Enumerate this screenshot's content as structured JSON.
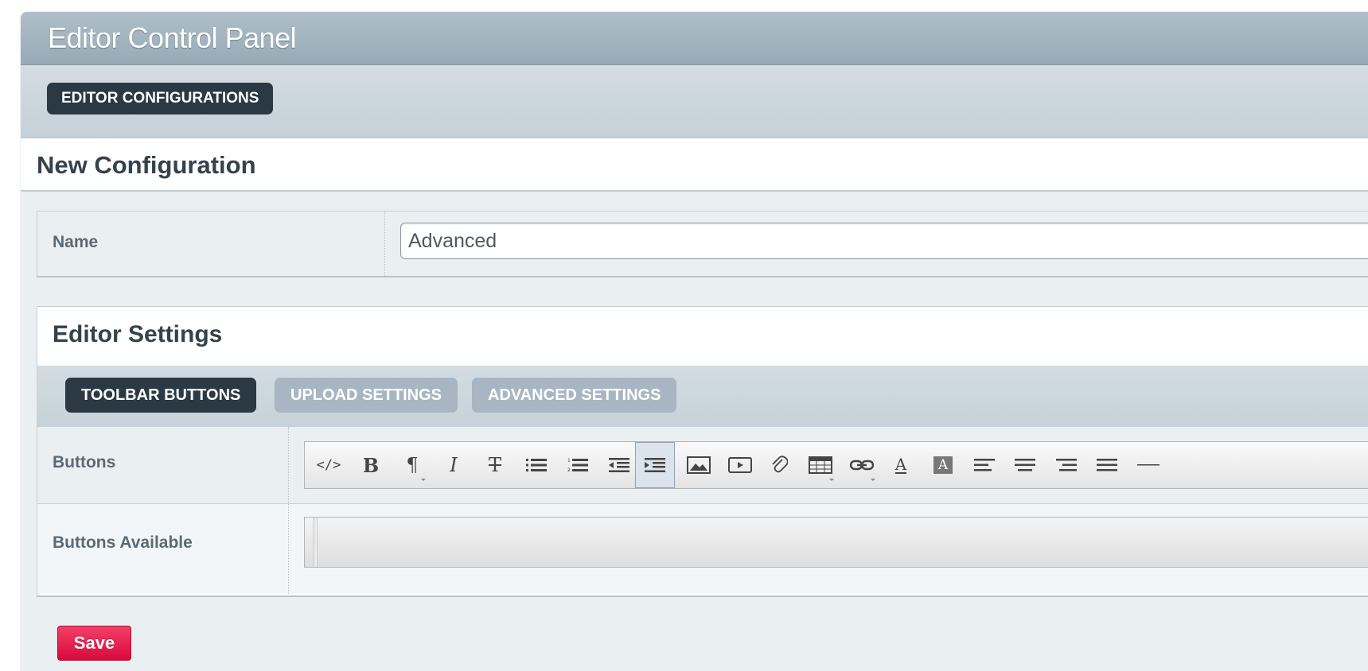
{
  "header": {
    "title": "Editor Control Panel"
  },
  "subnav": {
    "items": [
      {
        "label": "EDITOR CONFIGURATIONS"
      }
    ]
  },
  "page": {
    "heading": "New Configuration"
  },
  "name_field": {
    "label": "Name",
    "value": "Advanced"
  },
  "editor_settings": {
    "title": "Editor Settings",
    "tabs": [
      {
        "label": "TOOLBAR BUTTONS",
        "active": true
      },
      {
        "label": "UPLOAD SETTINGS",
        "active": false
      },
      {
        "label": "ADVANCED SETTINGS",
        "active": false
      }
    ],
    "buttons_label": "Buttons",
    "buttons_available_label": "Buttons Available",
    "toolbar_buttons": [
      {
        "icon": "html-code-icon"
      },
      {
        "icon": "bold-icon"
      },
      {
        "icon": "paragraph-format-icon",
        "dropdown": true
      },
      {
        "icon": "italic-icon"
      },
      {
        "icon": "strikethrough-icon"
      },
      {
        "icon": "unordered-list-icon"
      },
      {
        "icon": "ordered-list-icon"
      },
      {
        "icon": "outdent-icon"
      },
      {
        "icon": "indent-icon",
        "active": true
      },
      {
        "icon": "image-icon"
      },
      {
        "icon": "video-icon"
      },
      {
        "icon": "file-attachment-icon"
      },
      {
        "icon": "table-icon",
        "dropdown": true
      },
      {
        "icon": "link-icon",
        "dropdown": true
      },
      {
        "icon": "font-color-icon"
      },
      {
        "icon": "background-color-icon"
      },
      {
        "icon": "align-left-icon"
      },
      {
        "icon": "align-center-icon"
      },
      {
        "icon": "align-right-icon"
      },
      {
        "icon": "justify-icon"
      },
      {
        "icon": "horizontal-rule-icon"
      }
    ],
    "toolbar_glyphs": {
      "html": "</>",
      "bold": "B",
      "paragraph": "¶",
      "italic": "I",
      "strike": "T",
      "text_color": "A",
      "background": "A"
    }
  },
  "actions": {
    "save_label": "Save"
  },
  "colors": {
    "accent_dark": "#2a3943",
    "tab_inactive": "#a7b6c2",
    "save": "#e8174a",
    "panel_bg": "#eaeff2"
  }
}
